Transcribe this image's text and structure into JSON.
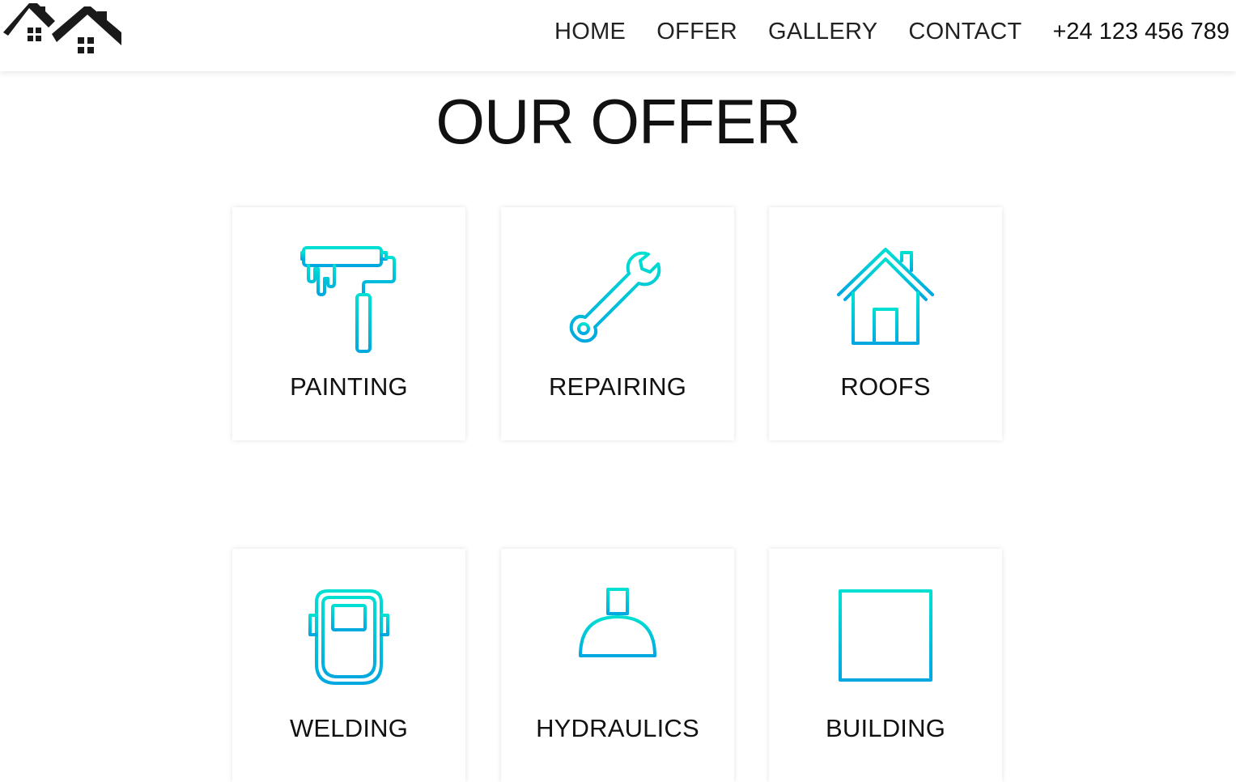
{
  "header": {
    "logo_icon": "houses-logo-icon",
    "nav": [
      "HOME",
      "OFFER",
      "GALLERY",
      "CONTACT"
    ],
    "phone": "+24 123 456 789"
  },
  "main": {
    "title": "OUR OFFER",
    "services": [
      {
        "label": "PAINTING",
        "icon": "paint-roller-icon"
      },
      {
        "label": "REPAIRING",
        "icon": "wrench-icon"
      },
      {
        "label": "ROOFS",
        "icon": "house-icon"
      },
      {
        "label": "WELDING",
        "icon": "welding-mask-icon"
      },
      {
        "label": "HYDRAULICS",
        "icon": "shower-head-icon"
      },
      {
        "label": "BUILDING",
        "icon": "brick-wall-icon"
      }
    ]
  },
  "colors": {
    "icon_gradient_top": "#00e0d2",
    "icon_gradient_bottom": "#00a8e0",
    "text": "#111111"
  }
}
